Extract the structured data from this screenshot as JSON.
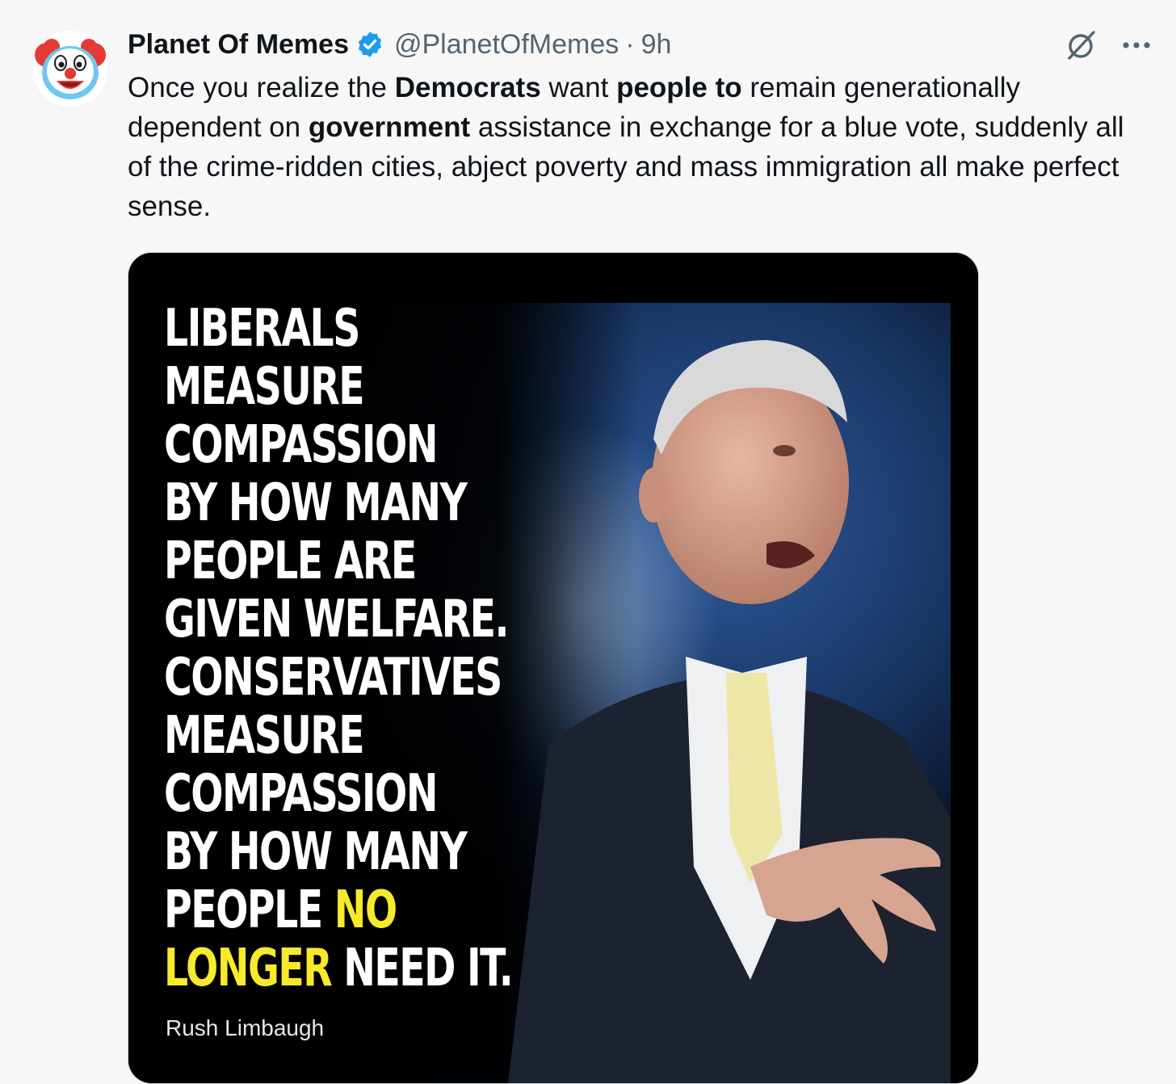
{
  "post": {
    "author": {
      "display_name": "Planet Of Memes",
      "handle": "@PlanetOfMemes",
      "verified": true,
      "avatar_icon": "clown-face-icon"
    },
    "separator": "·",
    "time": "9h",
    "actions": {
      "grok_icon": "grok-icon",
      "more_icon": "more-options-icon"
    },
    "text": {
      "s1": "Once you realize the ",
      "b1": "Democrats",
      "s2": " want ",
      "b2": "people to",
      "s3": " remain generationally dependent on ",
      "b3": "government",
      "s4": " assistance in exchange for a blue vote, suddenly all of the crime-ridden cities, abject poverty and mass immigration all make perfect sense."
    },
    "media": {
      "quote_lines": [
        "LIBERALS",
        "MEASURE",
        "COMPASSION",
        "BY HOW MANY",
        "PEOPLE ARE",
        "GIVEN WELFARE.",
        "CONSERVATIVES",
        "MEASURE",
        "COMPASSION",
        "BY HOW MANY"
      ],
      "line11_a": "PEOPLE ",
      "line11_b": "NO",
      "line12_a": "LONGER",
      "line12_b": " NEED IT.",
      "attribution": "Rush Limbaugh",
      "colors": {
        "text": "#ffffff",
        "highlight": "#f7ea2c",
        "background": "#000000"
      }
    }
  },
  "colors": {
    "page_bg": "#f7f7f7",
    "verified_blue": "#1d9bf0",
    "muted_text": "#536471",
    "primary_text": "#0f1419"
  }
}
